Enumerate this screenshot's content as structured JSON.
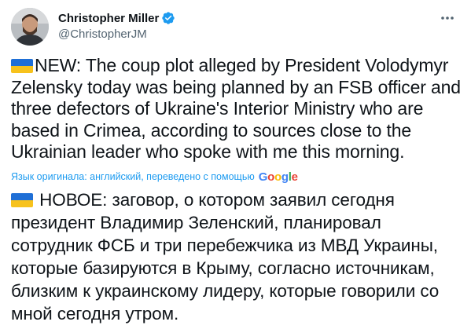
{
  "author": {
    "display_name": "Christopher Miller",
    "handle": "@ChristopherJM"
  },
  "tweet": {
    "text": "NEW: The coup plot alleged by President Volodymyr Zelensky today was being planned by an FSB officer and three defectors of Ukraine's Interior Ministry who are based in Crimea, according to sources close to the Ukrainian leader who spoke with me this morning.",
    "flag_icon": "ukraine-flag-icon"
  },
  "translation": {
    "note": "Язык оригинала: английский, переведено с помощью",
    "provider": "Google",
    "text": "НОВОЕ: заговор, о котором заявил сегодня президент Владимир Зеленский, планировал сотрудник ФСБ и три перебежчика из МВД Украины, которые базируются в Крыму, согласно источникам, близким к украинскому лидеру, которые говорили со мной сегодня утром."
  },
  "colors": {
    "verified": "#1d9bf0",
    "link": "#1d9bf0",
    "secondary_text": "#536471",
    "flag_blue": "#1f6fd6",
    "flag_yellow": "#f7c21c"
  }
}
